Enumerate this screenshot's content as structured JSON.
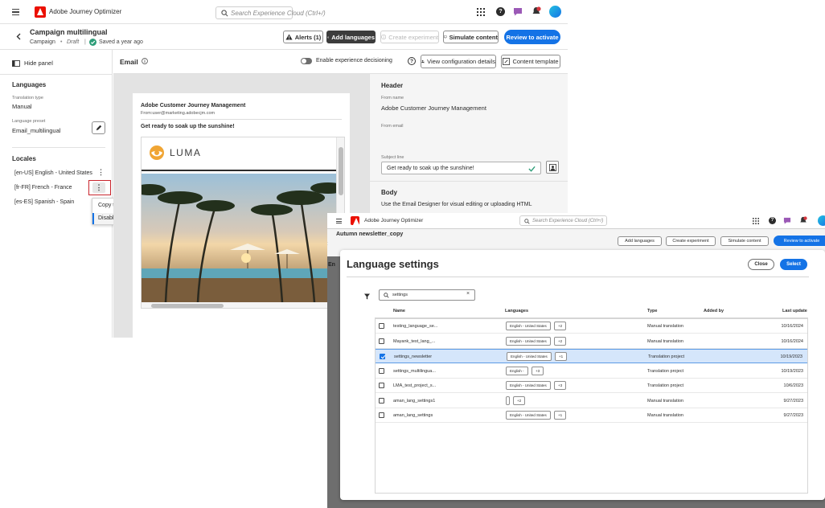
{
  "app": {
    "name": "Adobe Journey Optimizer",
    "search_placeholder": "Search Experience Cloud (Ctrl+/)",
    "colors": {
      "accent": "#1473e6",
      "brand": "#eb1000",
      "success": "#2d9d78"
    }
  },
  "campaign": {
    "title": "Campaign multilingual",
    "type": "Campaign",
    "status": "Draft",
    "saved": "Saved a year ago"
  },
  "header_actions": {
    "alerts": "Alerts (1)",
    "add_languages": "Add languages",
    "create_experiment": "Create experiment",
    "simulate_content": "Simulate content",
    "review_to_activate": "Review to activate"
  },
  "left_panel": {
    "hide_panel": "Hide panel",
    "languages_title": "Languages",
    "translation_type_label": "Translation type",
    "translation_type_value": "Manual",
    "language_preset_label": "Language preset",
    "language_preset_value": "Email_multilingual",
    "locales_title": "Locales",
    "locales": [
      {
        "label": "[en-US] English - United States"
      },
      {
        "label": "[fr-FR] French - France"
      },
      {
        "label": "[es-ES] Spanish - Spain"
      }
    ],
    "context_menu": {
      "copy": "Copy to other locales",
      "disable": "Disable locale"
    }
  },
  "email_bar": {
    "title": "Email",
    "decisioning": "Enable experience decisioning",
    "view_config": "View configuration details",
    "content_template": "Content template"
  },
  "email_preview": {
    "sender": "Adobe Customer Journey Management",
    "from": "From:user@marketing.adobecjm.com",
    "subject": "Get ready to soak up the sunshine!",
    "brand": "LUMA"
  },
  "right_panel": {
    "header_title": "Header",
    "from_name_label": "From name",
    "from_name_value": "Adobe Customer Journey Management",
    "from_email_label": "From email",
    "subject_label": "Subject line",
    "subject_value": "Get ready to soak up the sunshine!",
    "body_title": "Body",
    "body_text": "Use the Email Designer for visual editing or uploading HTML"
  },
  "shot2": {
    "header_campaign": "Autumn newsletter_copy",
    "header_actions": {
      "add_languages": "Add languages",
      "create_experiment": "Create experiment",
      "simulate_content": "Simulate content",
      "review": "Review to activate"
    },
    "side_letters": "En"
  },
  "dialog": {
    "title": "Language settings",
    "close": "Close",
    "select": "Select",
    "search_value": "settings",
    "columns": {
      "name": "Name",
      "languages": "Languages",
      "type": "Type",
      "added_by": "Added by",
      "last_update": "Last update"
    },
    "rows": [
      {
        "name": "testing_language_se...",
        "lang": "English - United States",
        "more": "+2",
        "type": "Manual translation",
        "date": "10/16/2024",
        "selected": false
      },
      {
        "name": "Mayank_test_lang_...",
        "lang": "English - United States",
        "more": "+2",
        "type": "Manual translation",
        "date": "10/16/2024",
        "selected": false
      },
      {
        "name": "settings_newsletter",
        "lang": "English - United States",
        "more": "+1",
        "type": "Translation project",
        "date": "10/19/2023",
        "selected": true
      },
      {
        "name": "settings_multilingua...",
        "lang": "English -",
        "more": "+3",
        "type": "Translation project",
        "date": "10/19/2023",
        "selected": false
      },
      {
        "name": "LMA_test_project_s...",
        "lang": "English - United States",
        "more": "+3",
        "type": "Translation project",
        "date": "10/6/2023",
        "selected": false
      },
      {
        "name": "aman_lang_settings1",
        "lang": "",
        "more": "+2",
        "type": "Manual translation",
        "date": "9/27/2023",
        "selected": false
      },
      {
        "name": "aman_lang_settings",
        "lang": "English - United States",
        "more": "+1",
        "type": "Manual translation",
        "date": "9/27/2023",
        "selected": false
      }
    ]
  }
}
